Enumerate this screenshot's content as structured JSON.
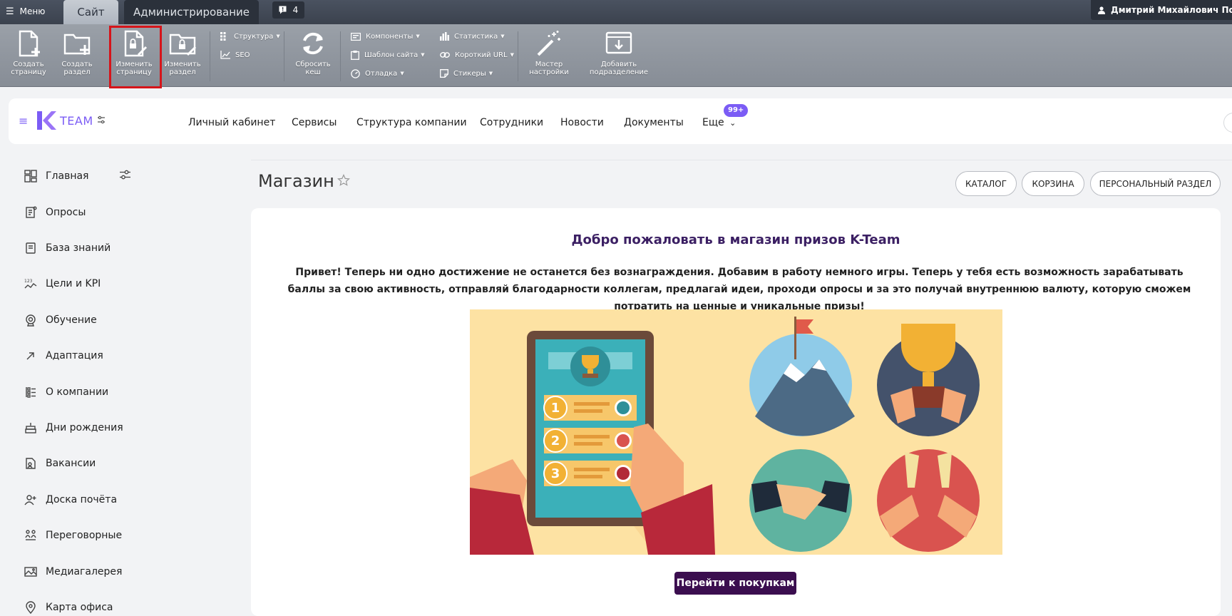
{
  "admin_bar": {
    "menu_label": "Меню",
    "tabs": [
      {
        "label": "Сайт"
      },
      {
        "label": "Администрирование"
      }
    ],
    "notifications_count": "4",
    "user_name": "Дмитрий Михайлович Покровский"
  },
  "toolbar": {
    "create_page": "Создать страницу",
    "create_section": "Создать раздел",
    "edit_page": "Изменить страницу",
    "edit_section": "Изменить раздел",
    "structure": "Структура",
    "seo": "SEO",
    "reset_cache": "Сбросить кеш",
    "components": "Компоненты",
    "site_template": "Шаблон сайта",
    "debug": "Отладка",
    "statistics": "Статистика",
    "short_url": "Короткий URL",
    "stickers": "Стикеры",
    "settings_wizard": "Мастер настройки",
    "add_subdivision": "Добавить подразделение"
  },
  "header": {
    "logo_text": "TEAM",
    "nav": [
      {
        "label": "Личный кабинет"
      },
      {
        "label": "Сервисы"
      },
      {
        "label": "Структура компании"
      },
      {
        "label": "Сотрудники"
      },
      {
        "label": "Новости"
      },
      {
        "label": "Документы"
      },
      {
        "label": "Еще"
      }
    ],
    "more_badge": "99+"
  },
  "sidebar": {
    "items": [
      {
        "label": "Главная",
        "icon": "dashboard-icon"
      },
      {
        "label": "Опросы",
        "icon": "survey-icon"
      },
      {
        "label": "База знаний",
        "icon": "book-icon"
      },
      {
        "label": "Цели и KPI",
        "icon": "kpi-icon"
      },
      {
        "label": "Обучение",
        "icon": "learning-icon"
      },
      {
        "label": "Адаптация",
        "icon": "arrow-icon"
      },
      {
        "label": "О компании",
        "icon": "company-icon"
      },
      {
        "label": "Дни рождения",
        "icon": "cake-icon"
      },
      {
        "label": "Вакансии",
        "icon": "vacancy-icon"
      },
      {
        "label": "Доска почёта",
        "icon": "honor-icon"
      },
      {
        "label": "Переговорные",
        "icon": "meeting-icon"
      },
      {
        "label": "Медиагалерея",
        "icon": "gallery-icon"
      },
      {
        "label": "Карта офиса",
        "icon": "map-pin-icon"
      }
    ]
  },
  "page": {
    "title": "Магазин",
    "buttons": {
      "catalog": "КАТАЛОГ",
      "cart": "КОРЗИНА",
      "personal": "ПЕРСОНАЛЬНЫЙ РАЗДЕЛ"
    },
    "welcome_title": "Добро пожаловать в магазин призов K-Team",
    "welcome_text": "Привет! Теперь ни одно достижение не останется без вознаграждения. Добавим в работу немного игры. Теперь у тебя есть возможность зарабатывать баллы за свою активность, отправляй благодарности коллегам, предлагай идеи, проходи опросы и за это получай внутреннюю валюту, которую сможем потратить на ценные и уникальные призы!",
    "shop_button": "Перейти к покупкам"
  },
  "colors": {
    "accent": "#7b5cf5",
    "admin_bar": "#3b424e",
    "toolbar": "#8f959d",
    "highlight": "#d6141a",
    "shop_button": "#3b0e4f",
    "image_bg": "#fde2a3"
  }
}
